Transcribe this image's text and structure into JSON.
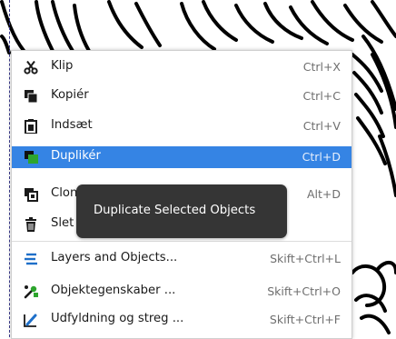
{
  "menu": {
    "items": [
      {
        "label": "Klip",
        "accel": "Ctrl+X",
        "icon": "scissors-icon"
      },
      {
        "label": "Kopiér",
        "accel": "Ctrl+C",
        "icon": "copy-icon"
      },
      {
        "label": "Indsæt",
        "accel": "Ctrl+V",
        "icon": "paste-icon"
      },
      {
        "label": "Duplikér",
        "accel": "Ctrl+D",
        "icon": "duplicate-icon",
        "selected": true
      },
      {
        "label": "Clone",
        "accel": "Alt+D",
        "icon": "clone-icon"
      },
      {
        "label": "Slet",
        "accel": "",
        "icon": "trash-icon"
      },
      {
        "label": "Layers and Objects...",
        "accel": "Skift+Ctrl+L",
        "icon": "layers-icon"
      },
      {
        "label": "Objektegenskaber ...",
        "accel": "Skift+Ctrl+O",
        "icon": "object-properties-icon"
      },
      {
        "label": "Udfyldning og streg ...",
        "accel": "Skift+Ctrl+F",
        "icon": "fill-stroke-icon"
      }
    ]
  },
  "tooltip": {
    "text": "Duplicate Selected Objects"
  },
  "colors": {
    "selection": "#3584e4",
    "tooltip_bg": "#353535",
    "duplicate_green": "#2ea52e"
  }
}
